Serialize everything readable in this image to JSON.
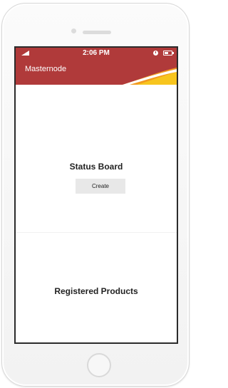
{
  "status_bar": {
    "time": "2:06 PM"
  },
  "header": {
    "title": "Masternode",
    "colors": {
      "primary": "#b03a3a",
      "accent_orange": "#f29a1f",
      "accent_yellow": "#f7c51e"
    }
  },
  "status_board": {
    "title": "Status Board",
    "create_label": "Create"
  },
  "registered_products": {
    "title": "Registered Products"
  },
  "icons": [
    "signal-icon",
    "clock-icon",
    "battery-icon"
  ]
}
